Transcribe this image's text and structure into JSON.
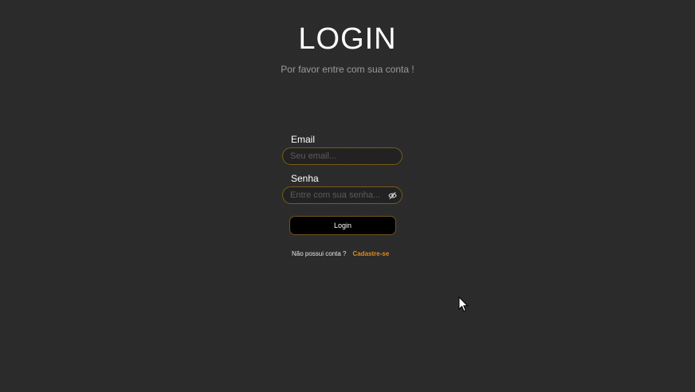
{
  "header": {
    "title": "LOGIN",
    "subtitle": "Por favor entre com sua conta !"
  },
  "form": {
    "email_label": "Email",
    "email_placeholder": "Seu email...",
    "password_label": "Senha",
    "password_placeholder": "Entre com sua senha...",
    "login_label": "Login"
  },
  "footer": {
    "signup_text": "Não possui conta ?",
    "signup_link": "Cadastre-se"
  },
  "icons": {
    "password_toggle": "eye-off-icon",
    "pointer": "mouse-cursor-icon"
  },
  "colors": {
    "background": "#2a2a2a",
    "accent": "#e08a1e",
    "input_border": "#7a5a1a",
    "button_bg": "#000000"
  }
}
